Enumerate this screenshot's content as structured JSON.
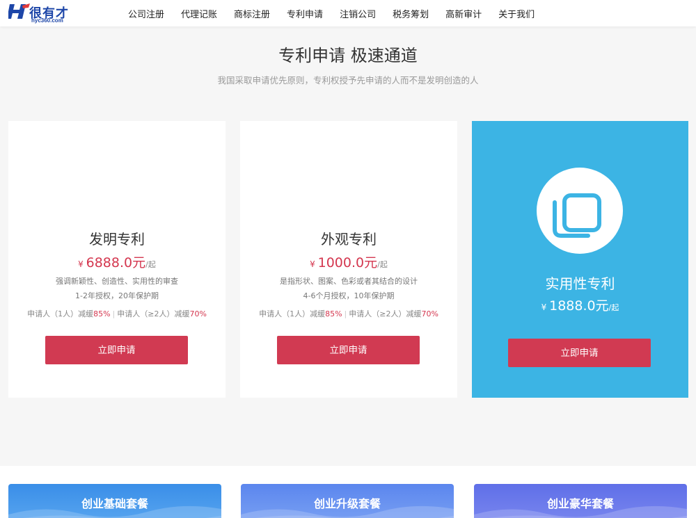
{
  "header": {
    "logo_text": "很有才",
    "logo_url": "hyc360.com",
    "nav": [
      "公司注册",
      "代理记账",
      "商标注册",
      "专利申请",
      "注销公司",
      "税务筹划",
      "高新审计",
      "关于我们"
    ]
  },
  "hero": {
    "title": "专利申请 极速通道",
    "subtitle": "我国采取申请优先原则，专利权授予先申请的人而不是发明创造的人"
  },
  "cards": [
    {
      "title": "发明专利",
      "currency": "¥",
      "price": "6888.0元",
      "unit": "/起",
      "desc1": "强调新颖性、创造性、实用性的审查",
      "desc2": "1-2年授权，20年保护期",
      "disc_a": "申请人（1人）减缓",
      "disc_a_pct": "85%",
      "disc_sep": "|",
      "disc_b": "申请人（≥2人）减缓",
      "disc_b_pct": "70%",
      "button": "立即申请"
    },
    {
      "title": "外观专利",
      "currency": "¥",
      "price": "1000.0元",
      "unit": "/起",
      "desc1": "是指形状、图案、色彩或者其结合的设计",
      "desc2": "4-6个月授权，10年保护期",
      "disc_a": "申请人（1人）减缓",
      "disc_a_pct": "85%",
      "disc_sep": "|",
      "disc_b": "申请人（≥2人）减缓",
      "disc_b_pct": "70%",
      "button": "立即申请"
    },
    {
      "title": "实用性专利",
      "currency": "¥",
      "price": "1888.0元",
      "unit": "/起",
      "button": "立即申请"
    }
  ],
  "packages": [
    "创业基础套餐",
    "创业升级套餐",
    "创业豪华套餐"
  ],
  "colors": {
    "accent_red": "#d13a52",
    "highlight_blue": "#3cb4e4",
    "brand_blue": "#1d46a8"
  },
  "icons": {
    "copy_icon": "copy-icon"
  }
}
